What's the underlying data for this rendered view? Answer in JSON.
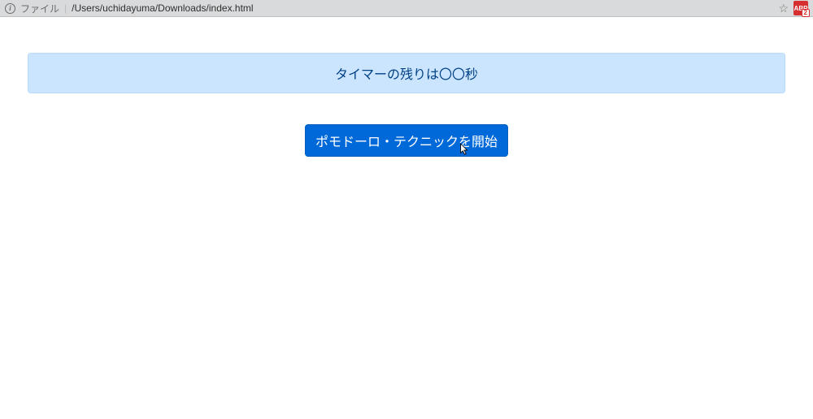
{
  "browser": {
    "scheme_label": "ファイル",
    "url_path": "/Users/uchidayuma/Downloads/index.html",
    "info_glyph": "i",
    "star_glyph": "☆",
    "extension": {
      "label": "ABP",
      "count": "2"
    }
  },
  "main": {
    "alert_text": "タイマーの残りは〇〇秒",
    "start_button_label": "ポモドーロ・テクニックを開始"
  }
}
